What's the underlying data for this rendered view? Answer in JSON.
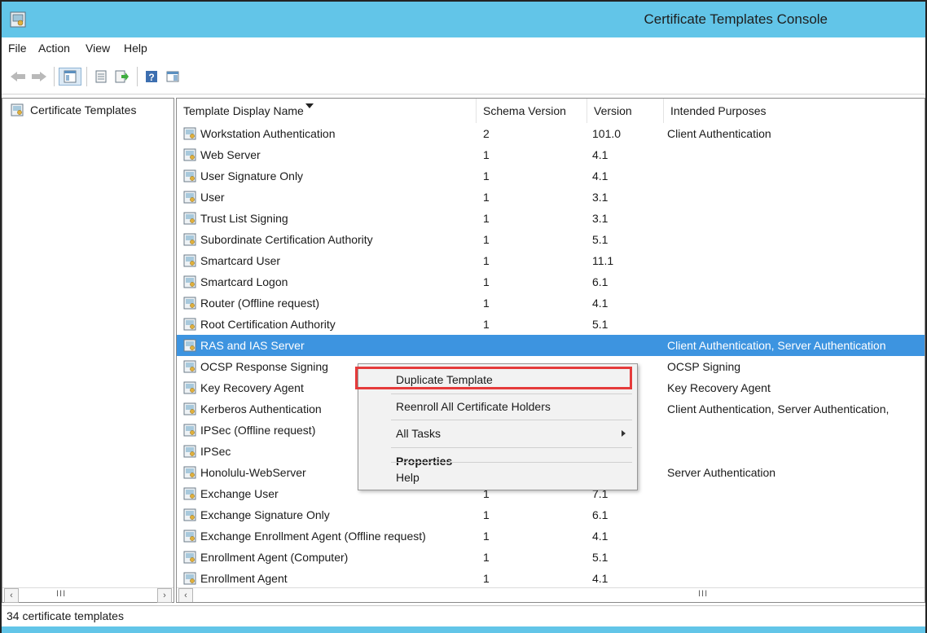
{
  "window": {
    "title": "Certificate Templates Console",
    "app_icon": "console-icon"
  },
  "menubar": {
    "items": [
      "File",
      "Action",
      "View",
      "Help"
    ]
  },
  "toolbar": {
    "buttons": [
      "back-icon",
      "forward-icon",
      "show-tree-icon",
      "properties-icon",
      "export-icon",
      "help-icon",
      "show-pane-icon"
    ]
  },
  "tree": {
    "root_label": "Certificate Templates"
  },
  "list": {
    "columns": {
      "name": "Template Display Name",
      "schema": "Schema Version",
      "version": "Version",
      "purposes": "Intended Purposes"
    },
    "rows": [
      {
        "name": "Workstation Authentication",
        "schema": "2",
        "version": "101.0",
        "purposes": "Client Authentication",
        "selected": false
      },
      {
        "name": "Web Server",
        "schema": "1",
        "version": "4.1",
        "purposes": "",
        "selected": false
      },
      {
        "name": "User Signature Only",
        "schema": "1",
        "version": "4.1",
        "purposes": "",
        "selected": false
      },
      {
        "name": "User",
        "schema": "1",
        "version": "3.1",
        "purposes": "",
        "selected": false
      },
      {
        "name": "Trust List Signing",
        "schema": "1",
        "version": "3.1",
        "purposes": "",
        "selected": false
      },
      {
        "name": "Subordinate Certification Authority",
        "schema": "1",
        "version": "5.1",
        "purposes": "",
        "selected": false
      },
      {
        "name": "Smartcard User",
        "schema": "1",
        "version": "11.1",
        "purposes": "",
        "selected": false
      },
      {
        "name": "Smartcard Logon",
        "schema": "1",
        "version": "6.1",
        "purposes": "",
        "selected": false
      },
      {
        "name": "Router (Offline request)",
        "schema": "1",
        "version": "4.1",
        "purposes": "",
        "selected": false
      },
      {
        "name": "Root Certification Authority",
        "schema": "1",
        "version": "5.1",
        "purposes": "",
        "selected": false
      },
      {
        "name": "RAS and IAS Server",
        "schema": "",
        "version": "",
        "purposes": "Client Authentication, Server Authentication",
        "selected": true
      },
      {
        "name": "OCSP Response Signing",
        "schema": "",
        "version": "",
        "purposes": "OCSP Signing",
        "selected": false
      },
      {
        "name": "Key Recovery Agent",
        "schema": "",
        "version": "",
        "purposes": "Key Recovery Agent",
        "selected": false
      },
      {
        "name": "Kerberos Authentication",
        "schema": "",
        "version": "",
        "purposes": "Client Authentication, Server Authentication,",
        "selected": false
      },
      {
        "name": "IPSec (Offline request)",
        "schema": "",
        "version": "",
        "purposes": "",
        "selected": false
      },
      {
        "name": "IPSec",
        "schema": "",
        "version": "",
        "purposes": "",
        "selected": false
      },
      {
        "name": "Honolulu-WebServer",
        "schema": "",
        "version": "",
        "purposes": "Server Authentication",
        "selected": false
      },
      {
        "name": "Exchange User",
        "schema": "1",
        "version": "7.1",
        "purposes": "",
        "selected": false
      },
      {
        "name": "Exchange Signature Only",
        "schema": "1",
        "version": "6.1",
        "purposes": "",
        "selected": false
      },
      {
        "name": "Exchange Enrollment Agent (Offline request)",
        "schema": "1",
        "version": "4.1",
        "purposes": "",
        "selected": false
      },
      {
        "name": "Enrollment Agent (Computer)",
        "schema": "1",
        "version": "5.1",
        "purposes": "",
        "selected": false
      },
      {
        "name": "Enrollment Agent",
        "schema": "1",
        "version": "4.1",
        "purposes": "",
        "selected": false
      }
    ]
  },
  "context_menu": {
    "duplicate": "Duplicate Template",
    "reenroll": "Reenroll All Certificate Holders",
    "all_tasks": "All Tasks",
    "properties": "Properties",
    "help": "Help"
  },
  "scrollbar": {
    "left": "‹",
    "right": "›",
    "grip": "III"
  },
  "statusbar": {
    "text": "34 certificate templates"
  },
  "colors": {
    "titlebar": "#62c5e8",
    "selection": "#3d94e0",
    "highlight_box": "#e53b3b"
  }
}
